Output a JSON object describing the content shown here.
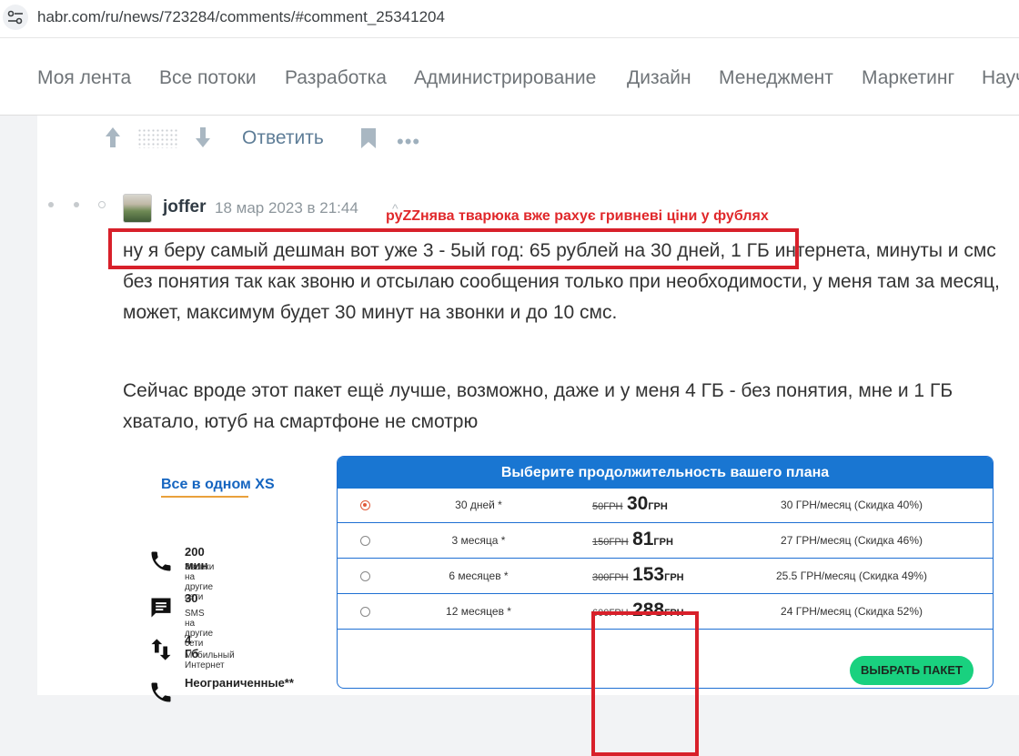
{
  "browser": {
    "url": "habr.com/ru/news/723284/comments/#comment_25341204"
  },
  "nav": {
    "items": [
      "Моя лента",
      "Все потоки",
      "Разработка",
      "Администрирование",
      "Дизайн",
      "Менеджмент",
      "Маркетинг",
      "Науч"
    ]
  },
  "actions": {
    "reply_label": "Ответить",
    "more": "•••"
  },
  "comment": {
    "author": "joffer",
    "date": "18 мар 2023 в 21:44",
    "annotation": "руZZнява тварюка вже рахує гривневі ціни у фублях",
    "paragraph1": "ну я беру самый дешман вот уже 3 - 5ый год: 65 рублей на 30 дней, 1 ГБ интернета, минуты и смс без понятия так как звоню и отсылаю сообщения только при необходимости, у меня там за месяц, может, максимум будет 30 минут на звонки и до 10 смс.",
    "paragraph2": "Сейчас вроде этот пакет ещё лучше, возможно, даже и у меня 4 ГБ - без понятия, мне и 1 ГБ хватало, ютуб на смартфоне не смотрю"
  },
  "plan": {
    "name": "Все в одном XS",
    "features": [
      {
        "title": "200 мин",
        "subtitle": "Звонки на другие сети",
        "icon": "phone-icon"
      },
      {
        "title": "30",
        "subtitle": "SMS на другие сети",
        "icon": "sms-icon"
      },
      {
        "title": "4 Гб",
        "subtitle": "Мобильный Интернет",
        "icon": "data-transfer-icon"
      },
      {
        "title": "Неограниченные**",
        "subtitle": "",
        "icon": "phone-icon"
      }
    ],
    "table_title": "Выберите продолжительность вашего плана",
    "currency": "ГРН",
    "rows": [
      {
        "period": "30 дней *",
        "old_price": "50",
        "new_price": "30",
        "monthly": "30 ГРН/месяц (Скидка 40%)",
        "selected": true
      },
      {
        "period": "3 месяца *",
        "old_price": "150",
        "new_price": "81",
        "monthly": "27 ГРН/месяц (Скидка 46%)",
        "selected": false
      },
      {
        "period": "6 месяцев *",
        "old_price": "300",
        "new_price": "153",
        "monthly": "25.5 ГРН/месяц (Скидка 49%)",
        "selected": false
      },
      {
        "period": "12 месяцев *",
        "old_price": "600",
        "new_price": "288",
        "monthly": "24 ГРН/месяц (Скидка 52%)",
        "selected": false
      }
    ],
    "buy_label": "ВЫБРАТЬ ПАКЕТ"
  },
  "colors": {
    "highlight": "#d8202a",
    "accent_blue": "#1976d2",
    "buy_green": "#19d17f"
  }
}
